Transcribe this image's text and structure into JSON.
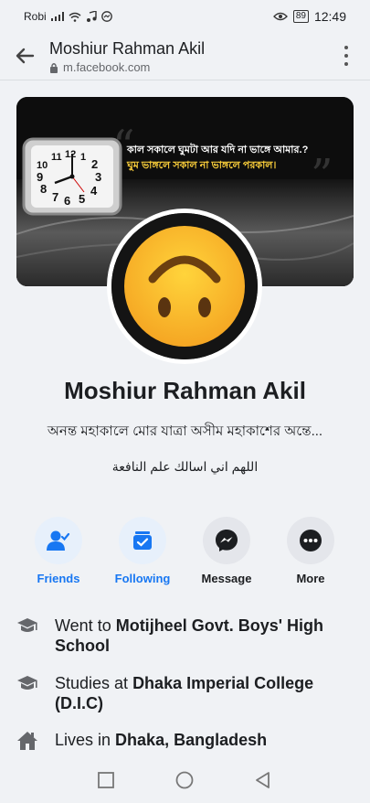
{
  "status_bar": {
    "carrier": "Robi",
    "battery": "89",
    "time": "12:49"
  },
  "browser": {
    "title": "Moshiur Rahman Akil",
    "url": "m.facebook.com"
  },
  "cover": {
    "line1": "কাল সকালে ঘুমটা আর যদি না ভাঙ্গে আমার.?",
    "line2": "ঘুম ভাঙ্গলে সকাল না ভাঙ্গলে পরকাল।",
    "clock_numbers": [
      "10",
      "11",
      "12",
      "1",
      "2",
      "3",
      "4",
      "5",
      "6",
      "7",
      "8",
      "9"
    ]
  },
  "profile": {
    "name": "Moshiur Rahman Akil",
    "bio": "অনন্ত মহাকালে মোর যাত্রা অসীম মহাকাশের অন্তে...",
    "bio_arabic": "اللهم اني اسالك علم النافعة"
  },
  "actions": [
    {
      "label": "Friends",
      "icon": "friends-icon",
      "active": true
    },
    {
      "label": "Following",
      "icon": "following-icon",
      "active": true
    },
    {
      "label": "Message",
      "icon": "messenger-icon",
      "active": false
    },
    {
      "label": "More",
      "icon": "more-icon",
      "active": false
    }
  ],
  "info": {
    "school": {
      "prefix": "Went to ",
      "value": "Motijheel Govt. Boys' High School"
    },
    "college": {
      "prefix": "Studies at ",
      "value": "Dhaka Imperial College (D.I.C)"
    },
    "lives": {
      "prefix": "Lives in ",
      "value": "Dhaka, Bangladesh"
    }
  },
  "colors": {
    "accent": "#1877f2",
    "background": "#f0f2f5",
    "text": "#1c1e21"
  }
}
